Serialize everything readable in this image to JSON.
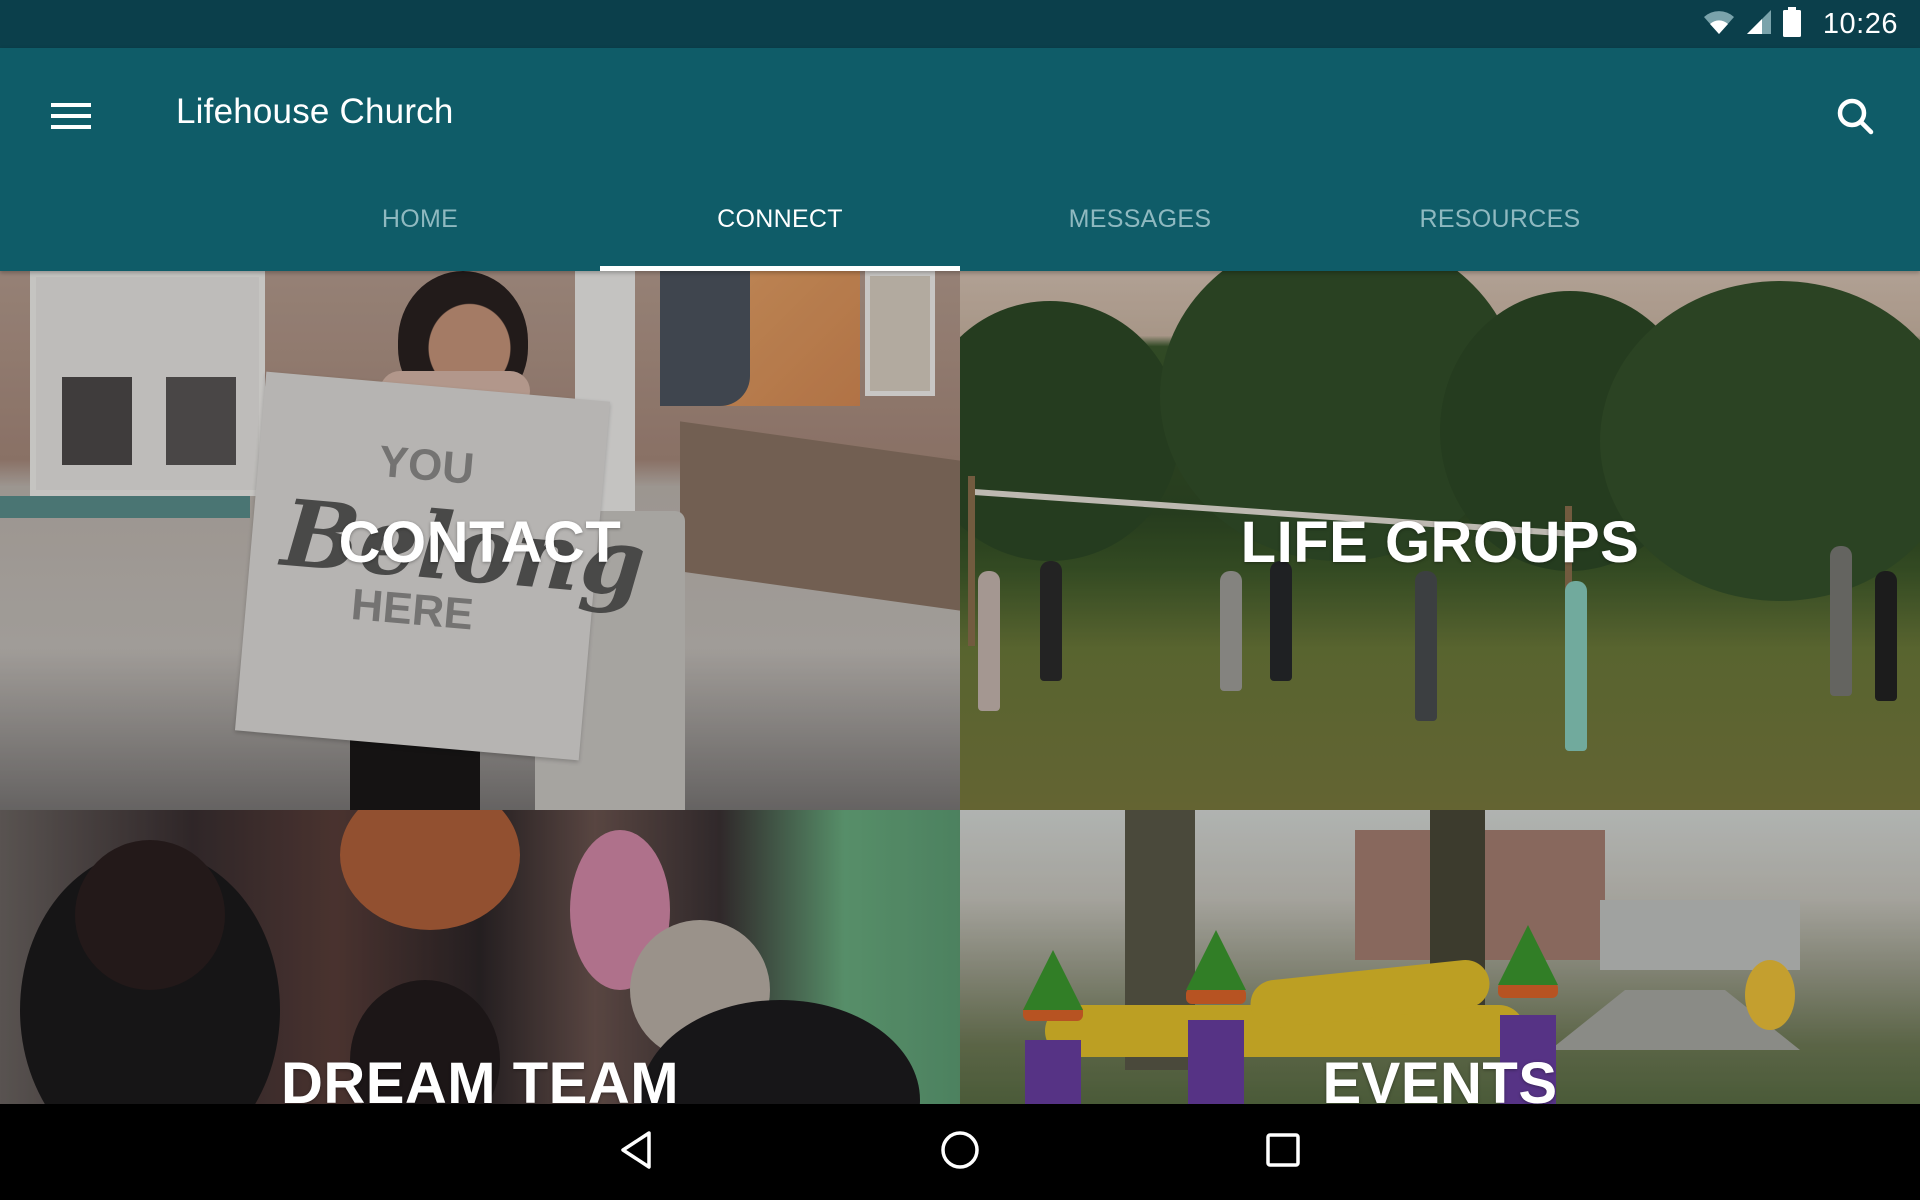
{
  "status_bar": {
    "time": "10:26",
    "icons": [
      "wifi-icon",
      "cell-signal-icon",
      "battery-icon"
    ]
  },
  "app_bar": {
    "title": "Lifehouse Church",
    "menu_icon": "hamburger-menu-icon",
    "search_icon": "search-icon"
  },
  "tabs": [
    {
      "label": "HOME",
      "active": false
    },
    {
      "label": "CONNECT",
      "active": true
    },
    {
      "label": "MESSAGES",
      "active": false
    },
    {
      "label": "RESOURCES",
      "active": false
    }
  ],
  "tiles": [
    {
      "label": "CONTACT",
      "image": "woman holding 'You Belong Here' sign outside church"
    },
    {
      "label": "LIFE GROUPS",
      "image": "group playing volleyball in park"
    },
    {
      "label": "DREAM TEAM",
      "image": "volunteers talking with people"
    },
    {
      "label": "EVENTS",
      "image": "bounce castle at outdoor event"
    }
  ],
  "photo_text": {
    "sign_you": "YOU",
    "sign_script": "Belong",
    "sign_here": "HERE"
  },
  "nav_bar": {
    "back_icon": "back-triangle-icon",
    "home_icon": "home-circle-icon",
    "recents_icon": "recents-square-icon"
  },
  "colors": {
    "status_bar": "#0b3f4b",
    "app_bar": "#0f5c68",
    "tab_active": "#ffffff",
    "tab_inactive": "#8fb9c0",
    "nav_bar": "#000000"
  }
}
